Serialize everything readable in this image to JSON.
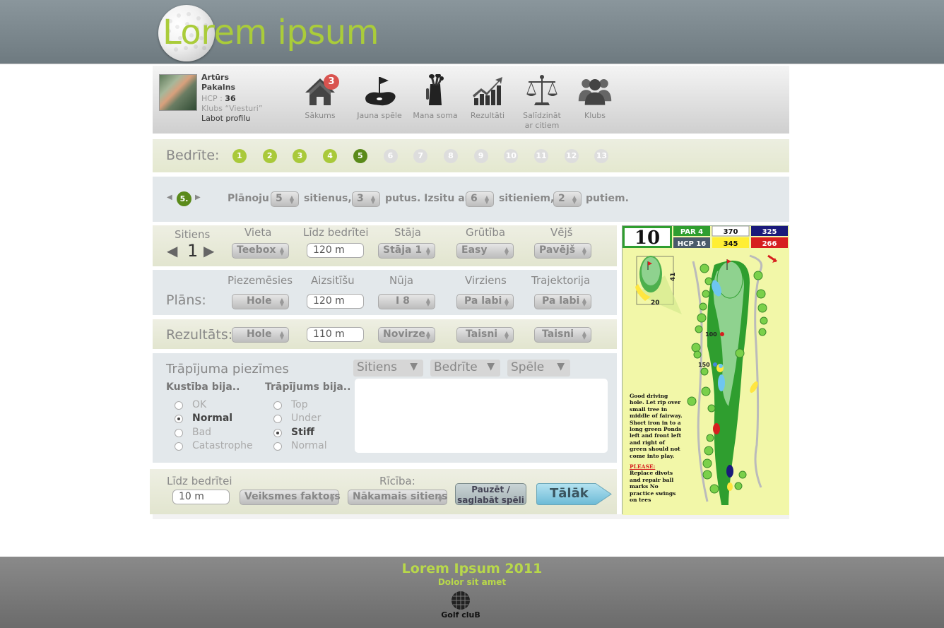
{
  "header": {
    "logo_text": "Lorem ipsum"
  },
  "profile": {
    "first_name": "Artūrs",
    "last_name": "Pakalns",
    "hcp_label": "HCP :",
    "hcp_value": "36",
    "club": "Klubs “Viesturi”",
    "edit_label": "Labot profilu"
  },
  "nav": {
    "home": {
      "label": "Sākums",
      "badge": "3"
    },
    "new_game": {
      "label": "Jauna spēle"
    },
    "bag": {
      "label": "Mana soma"
    },
    "results": {
      "label": "Rezultāti"
    },
    "compare": {
      "label_line1": "Salīdzināt",
      "label_line2": "ar citiem"
    },
    "clubs": {
      "label": "Klubs"
    }
  },
  "holes": {
    "label": "Bedrīte:",
    "items": [
      "1",
      "2",
      "3",
      "4",
      "5",
      "6",
      "7",
      "8",
      "9",
      "10",
      "11",
      "12",
      "13"
    ],
    "current": "5"
  },
  "plan": {
    "hole_badge": "5.",
    "t1": "Plānoju",
    "strokes_value": "5",
    "t2": "sitienus,",
    "putts_value": "3",
    "t3": "putus. Izsitu ar",
    "hit_value": "6",
    "t4": "sitieniem,",
    "hit_putts_value": "2",
    "t5": "putiem."
  },
  "shot": {
    "stroke_label": "Sitiens",
    "stroke_number": "1",
    "place_label": "Vieta",
    "place_value": "Teebox",
    "dist_label": "Līdz bedrītei",
    "dist_value": "120 m",
    "stance_label": "Stāja",
    "stance_value": "Stāja 1",
    "diff_label": "Grūtība",
    "diff_value": "Easy",
    "wind_label": "Vējš",
    "wind_value": "Pavējš"
  },
  "planrow": {
    "label": "Plāns:",
    "land_label": "Piezemēsies",
    "land_value": "Hole",
    "carry_label": "Aizsitīšu",
    "carry_value": "120 m",
    "club_label": "Nūja",
    "club_value": "I 8",
    "dir_label": "Virziens",
    "dir_value": "Pa labi",
    "traj_label": "Trajektorija",
    "traj_value": "Pa labi"
  },
  "result": {
    "label": "Rezultāts:",
    "land_value": "Hole",
    "dist_value": "110 m",
    "dev_value": "Novirze",
    "dir_value": "Taisni",
    "traj_value": "Taisni"
  },
  "notes": {
    "title": "Trāpījuma piezīmes",
    "dd1": "Sitiens",
    "dd2": "Bedrīte",
    "dd3": "Spēle",
    "motion_label": "Kustība bija..",
    "motion_options": [
      "OK",
      "Normal",
      "Bad",
      "Catastrophe"
    ],
    "hit_label": "Trāpījums bija..",
    "hit_options": [
      "Top",
      "Under",
      "Stiff",
      "Normal"
    ]
  },
  "bottom": {
    "dist_label": "Līdz bedrītei",
    "dist_value": "10 m",
    "luck_value": "Veiksmes faktors",
    "action_label": "Rīcība:",
    "action_value": "Nākamais sitiens",
    "pause_line1": "Pauzēt /",
    "pause_line2": "saglabāt spēli",
    "next_label": "Tālāk"
  },
  "card": {
    "hole_number": "10",
    "par": "PAR 4",
    "hcp": "HCP 16",
    "white": "370",
    "yellow": "345",
    "blue": "325",
    "red": "266",
    "inset_41": "41",
    "inset_20": "20",
    "m100": "100",
    "m150": "150",
    "tip": "Good driving hole. Let rip over small tree in middle of fairway. Short iron in to a long green Ponds left and front left and right of green should not come into play.",
    "please_title": "PLEASE:",
    "please_text": "Replace divots and repair ball marks No practice swings on tees",
    "colors": {
      "green": "#2f9e2f",
      "white": "#ffffff",
      "yellow": "#ffee33",
      "blue": "#1a1a7a",
      "red": "#d61f1f",
      "hcp_bg": "#4a5a6a"
    }
  },
  "footer": {
    "title": "Lorem Ipsum 2011",
    "subtitle": "Dolor sit amet",
    "logo_text": "Golf cluB"
  }
}
